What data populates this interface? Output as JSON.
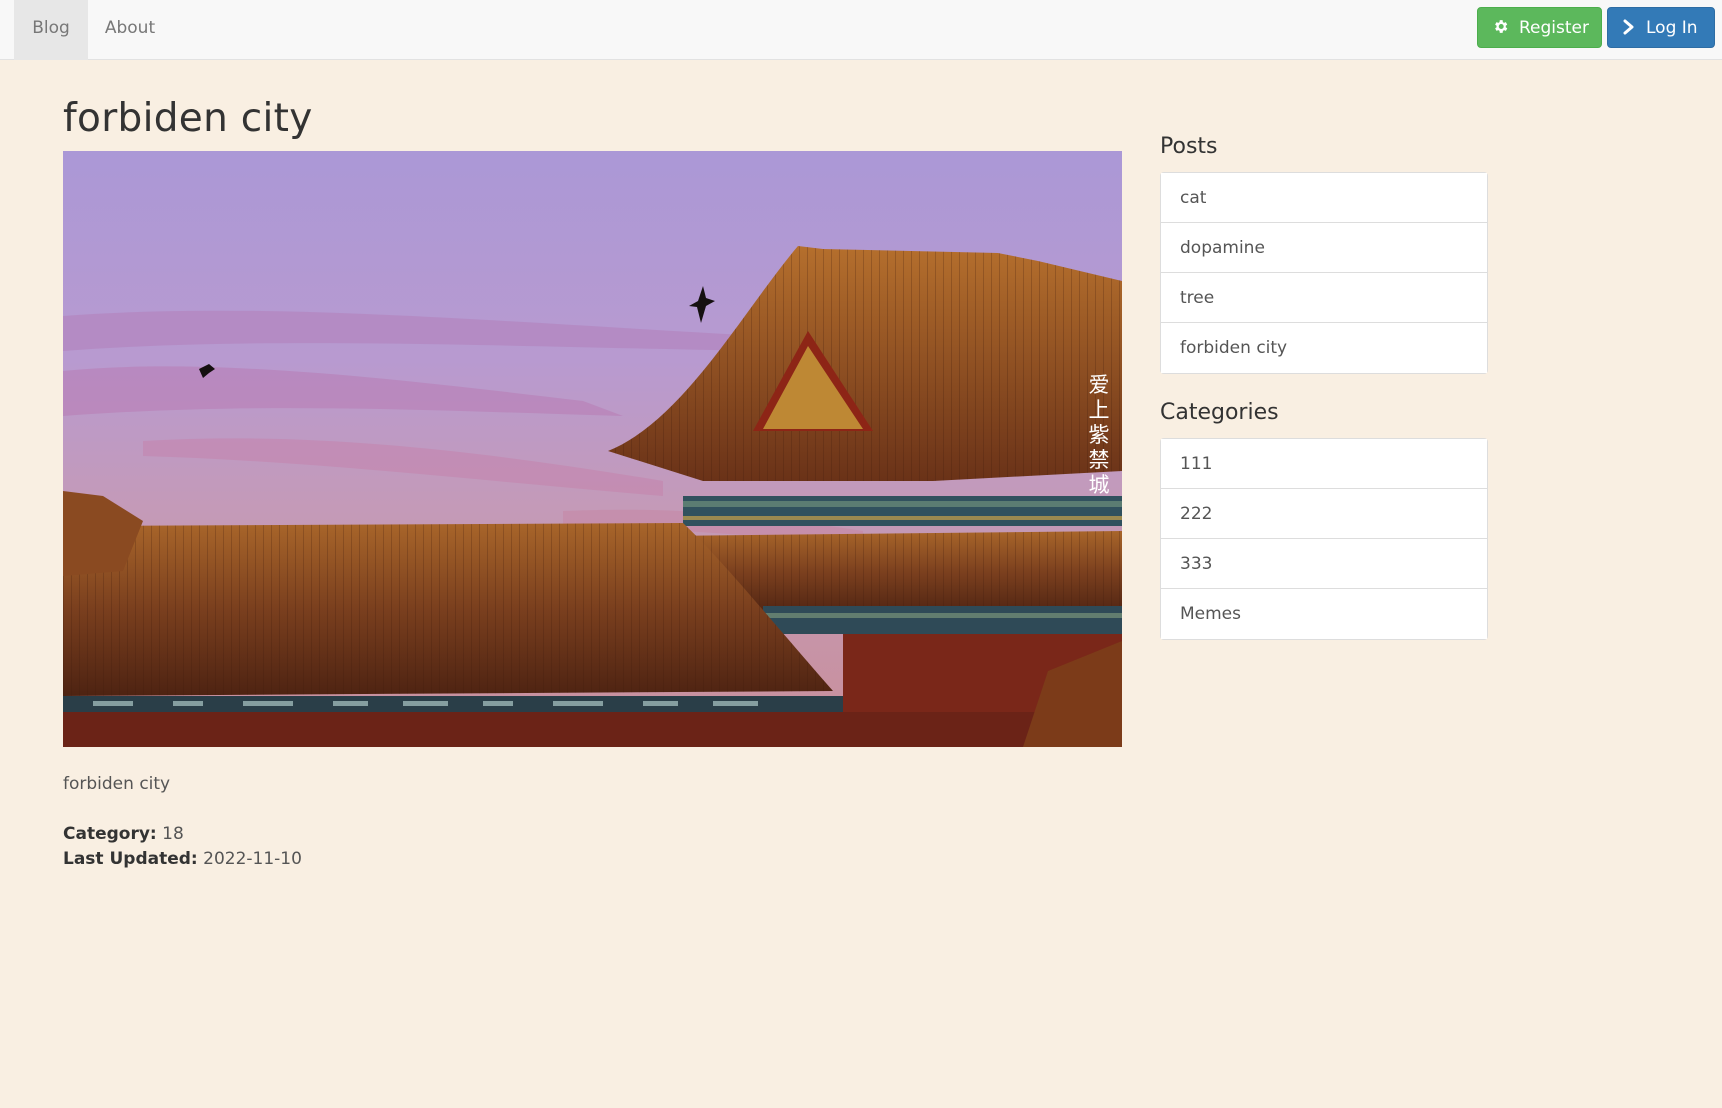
{
  "navbar": {
    "links": [
      {
        "label": "Blog",
        "active": true
      },
      {
        "label": "About",
        "active": false
      }
    ],
    "register_label": "Register",
    "register_icon": "gear-icon",
    "register_color": "#5cb85c",
    "login_label": "Log In",
    "login_icon": "chevron-right-icon",
    "login_color": "#337ab7"
  },
  "post": {
    "title": "forbiden city",
    "image_watermark": "爱上紫禁城",
    "body": "forbiden city",
    "category_label": "Category:",
    "category_value": "18",
    "updated_label": "Last Updated:",
    "updated_value": "2022-11-10"
  },
  "sidebar": {
    "posts_heading": "Posts",
    "posts": [
      "cat",
      "dopamine",
      "tree",
      "forbiden city"
    ],
    "categories_heading": "Categories",
    "categories": [
      "111",
      "222",
      "333",
      "Memes"
    ]
  },
  "colors": {
    "page_background": "#f9efe2",
    "navbar_background": "#f8f8f8"
  }
}
